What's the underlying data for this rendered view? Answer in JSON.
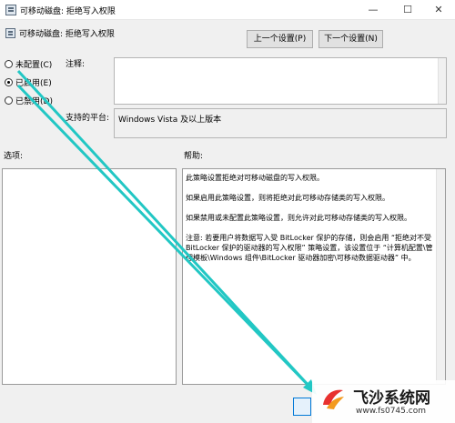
{
  "window": {
    "title": "可移动磁盘: 拒绝写入权限",
    "minimize_glyph": "—",
    "maximize_glyph": "☐",
    "close_glyph": "✕"
  },
  "header": {
    "policy_title": "可移动磁盘: 拒绝写入权限",
    "prev_button": "上一个设置(P)",
    "next_button": "下一个设置(N)"
  },
  "state": {
    "options": [
      {
        "label": "未配置(C)",
        "selected": false
      },
      {
        "label": "已启用(E)",
        "selected": true
      },
      {
        "label": "已禁用(D)",
        "selected": false
      }
    ]
  },
  "comment": {
    "label": "注释:",
    "value": ""
  },
  "platform": {
    "label": "支持的平台:",
    "value": "Windows Vista 及以上版本"
  },
  "panes": {
    "options_label": "选项:",
    "help_label": "帮助:"
  },
  "help": {
    "paragraphs": [
      "此策略设置拒绝对可移动磁盘的写入权限。",
      "如果启用此策略设置，则将拒绝对此可移动存储类的写入权限。",
      "如果禁用或未配置此策略设置，则允许对此可移动存储类的写入权限。",
      "注意: 若要用户将数据写入受 BitLocker 保护的存储，则会启用 “拒绝对不受 BitLocker 保护的驱动器的写入权限” 策略设置，该设置位于 “计算机配置\\管理模板\\Windows 组件\\BitLocker 驱动器加密\\可移动数据驱动器” 中。"
    ]
  },
  "watermark": {
    "name": "飞沙系统网",
    "url": "www.fs0745.com"
  },
  "colors": {
    "annotation_arrow": "#22c7c4",
    "window_bg": "#f0f0f0"
  }
}
